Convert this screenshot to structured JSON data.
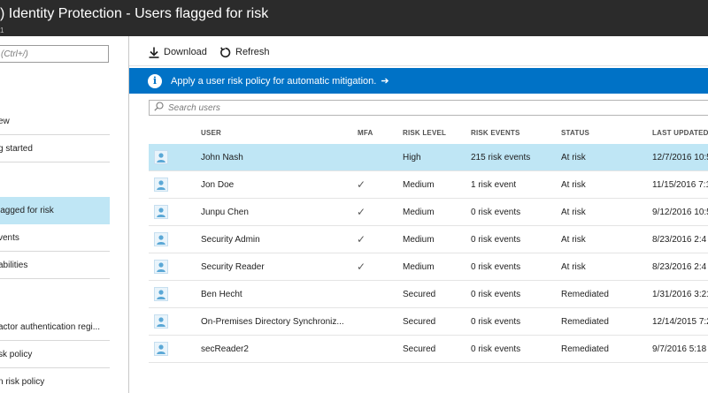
{
  "header": {
    "title": ") Identity Protection - Users flagged for risk",
    "subtitle": "1"
  },
  "sidebar": {
    "search_placeholder": "(Ctrl+/)",
    "items": [
      {
        "label": "ew"
      },
      {
        "label": "g started"
      },
      {
        "label": "lagged for risk"
      },
      {
        "label": "vents"
      },
      {
        "label": "abilities"
      },
      {
        "label": "actor authentication regi..."
      },
      {
        "label": "sk policy"
      },
      {
        "label": "n risk policy"
      }
    ]
  },
  "toolbar": {
    "download_label": "Download",
    "refresh_label": "Refresh"
  },
  "banner": {
    "message": "Apply a user risk policy for automatic mitigation.",
    "arrow": "➔"
  },
  "search": {
    "placeholder": "Search users"
  },
  "table": {
    "columns": [
      "USER",
      "MFA",
      "RISK LEVEL",
      "RISK EVENTS",
      "STATUS",
      "LAST UPDATED"
    ],
    "rows": [
      {
        "user": "John Nash",
        "mfa": "",
        "risk_level": "High",
        "risk_events": "215 risk events",
        "status": "At risk",
        "last_updated": "12/7/2016 10:5"
      },
      {
        "user": "Jon Doe",
        "mfa": "✓",
        "risk_level": "Medium",
        "risk_events": "1 risk event",
        "status": "At risk",
        "last_updated": "11/15/2016 7:1"
      },
      {
        "user": "Junpu Chen",
        "mfa": "✓",
        "risk_level": "Medium",
        "risk_events": "0 risk events",
        "status": "At risk",
        "last_updated": "9/12/2016 10:5"
      },
      {
        "user": "Security Admin",
        "mfa": "✓",
        "risk_level": "Medium",
        "risk_events": "0 risk events",
        "status": "At risk",
        "last_updated": "8/23/2016 2:4"
      },
      {
        "user": "Security Reader",
        "mfa": "✓",
        "risk_level": "Medium",
        "risk_events": "0 risk events",
        "status": "At risk",
        "last_updated": "8/23/2016 2:4"
      },
      {
        "user": "Ben Hecht",
        "mfa": "",
        "risk_level": "Secured",
        "risk_events": "0 risk events",
        "status": "Remediated",
        "last_updated": "1/31/2016 3:21"
      },
      {
        "user": "On-Premises Directory Synchroniz...",
        "mfa": "",
        "risk_level": "Secured",
        "risk_events": "0 risk events",
        "status": "Remediated",
        "last_updated": "12/14/2015 7:2"
      },
      {
        "user": "secReader2",
        "mfa": "",
        "risk_level": "Secured",
        "risk_events": "0 risk events",
        "status": "Remediated",
        "last_updated": "9/7/2016 5:18"
      }
    ]
  },
  "colors": {
    "titlebar": "#2b2b2b",
    "banner": "#0072c6",
    "selection": "#bfe6f5"
  }
}
